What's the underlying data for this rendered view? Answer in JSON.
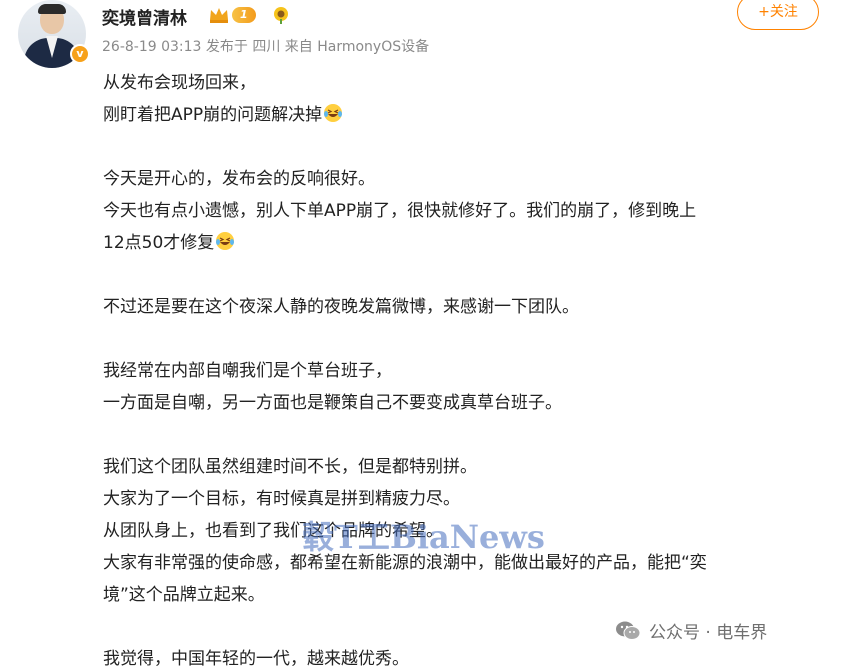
{
  "header": {
    "username": "奕境曾清林",
    "level_badge": "1",
    "follow_label": "+关注",
    "meta": "26-8-19 03:13  发布于 四川  来自 HarmonyOS设备"
  },
  "post": {
    "lines": [
      "从发布会现场回来，",
      "刚盯着把APP崩的问题解决掉",
      "今天是开心的，发布会的反响很好。",
      "今天也有点小遗憾，别人下单APP崩了，很快就修好了。我们的崩了，修到晚上",
      "12点50才修复",
      "不过还是要在这个夜深人静的夜晚发篇微博，来感谢一下团队。",
      "我经常在内部自嘲我们是个草台班子，",
      "一方面是自嘲，另一方面也是鞭策自己不要变成真草台班子。",
      "我们这个团队虽然组建时间不长，但是都特别拼。",
      "大家为了一个目标，有时候真是拼到精疲力尽。",
      "从团队身上，也看到了我们这个品牌的希望。",
      "大家有非常强的使命感，都希望在新能源的浪潮中，能做出最好的产品，能把“奕",
      "境”这个品牌立起来。",
      "我觉得，中国年轻的一代，越来越优秀。"
    ]
  },
  "watermark": "毂T工BiaNews",
  "source_label": "公众号 · 电车界",
  "icons": {
    "verified": "verified-v-icon",
    "crown": "crown-icon",
    "flower": "sunflower-icon",
    "emoji": "laugh-cry-emoji-icon",
    "wechat": "wechat-icon"
  },
  "colors": {
    "accent": "#ff8200",
    "meta": "#8a8a8a",
    "verified": "#f7a11a"
  }
}
